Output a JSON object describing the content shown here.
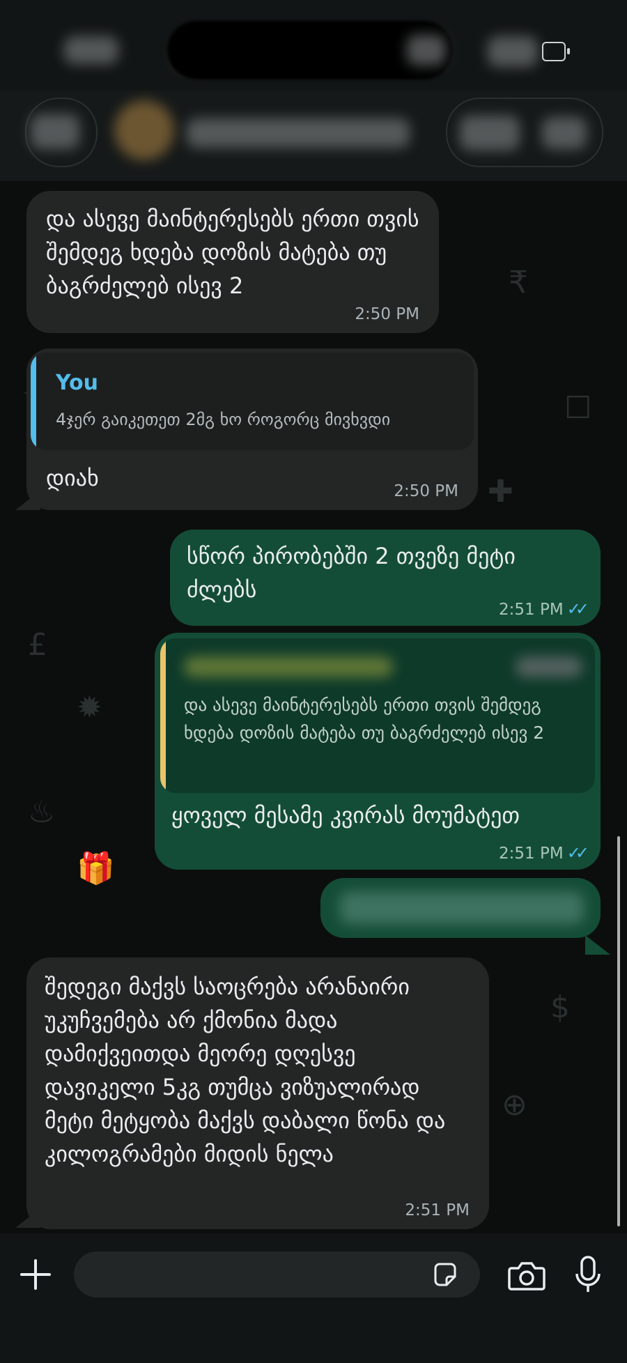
{
  "messages": [
    {
      "text": "და ასევე მაინტერესებს ერთი თვის შემდეგ ხდება დოზის მატება თუ ბაგრძელებ ისევ 2",
      "time": "2:50 PM"
    },
    {
      "quote_author": "You",
      "quote_text": "4ჯერ გაიკეთეთ 2მგ ხო როგორც მივხვდი",
      "text": "დიახ",
      "time": "2:50 PM"
    },
    {
      "text": "სწორ პირობებში 2 თვეზე მეტი ძლებს",
      "time": "2:51 PM",
      "status": "read"
    },
    {
      "quote_text": "და ასევე მაინტერესებს ერთი თვის შემდეგ ხდება დოზის მატება თუ ბაგრძელებ ისევ 2",
      "text": "ყოველ მესამე კვირას მოუმატეთ",
      "time": "2:51 PM",
      "status": "read"
    },
    {
      "text": "შედეგი მაქვს საოცრება არანაირი უკუჩვემება არ ქმონია მადა დამიქვეითდა მეორე დღესვე დავიკელი 5კგ თუმცა ვიზუალირად მეტი მეტყობა მაქვს დაბალი წონა და კილოგრამები მიდის ნელა",
      "time": "2:51 PM"
    }
  ],
  "icons": {
    "add": "plus-icon",
    "sticker": "sticker-icon",
    "camera": "camera-icon",
    "mic": "microphone-icon",
    "read_receipt": "double-check-icon"
  },
  "colors": {
    "incoming_bubble": "#242626",
    "outgoing_bubble": "#144d37",
    "read_tick": "#53bdeb",
    "quote_bar_self": "#53bdeb",
    "quote_bar_other": "#e9c46a"
  }
}
